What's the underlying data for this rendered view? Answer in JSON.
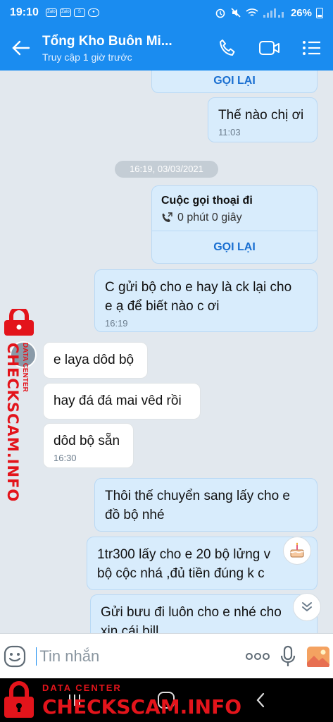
{
  "status_bar": {
    "time": "19:10",
    "notifications": [
      "Zalo",
      "Zalo",
      "S",
      "chat"
    ],
    "battery": "26%"
  },
  "header": {
    "title": "Tổng Kho Buôn Mi...",
    "subtitle": "Truy cập 1 giờ trước",
    "icons": [
      "back-arrow-icon",
      "phone-icon",
      "video-icon",
      "menu-icon"
    ]
  },
  "chat": {
    "top_callback_label": "GỌI LẠI",
    "messages": [
      {
        "side": "out",
        "text": "Thế nào chị ơi",
        "time": "11:03"
      },
      {
        "side": "separator",
        "text": "16:19, 03/03/2021"
      },
      {
        "side": "call",
        "title": "Cuộc gọi thoại đi",
        "duration": "0 phút 0 giây",
        "action": "GỌI LẠI"
      },
      {
        "side": "out",
        "lines": [
          "C gửi bộ cho e hay là ck lại cho",
          "e ạ để biết nào c ơi"
        ],
        "time": "16:19"
      },
      {
        "side": "in",
        "text": "e laya dôd bộ"
      },
      {
        "side": "in",
        "text": "hay đá đá mai vêd rồi"
      },
      {
        "side": "in",
        "text": "dôd bộ sẵn",
        "time": "16:30"
      },
      {
        "side": "out",
        "lines": [
          "Thôi thế chuyển sang lấy cho e",
          "đồ bộ nhé"
        ]
      },
      {
        "side": "out",
        "lines": [
          "1tr300 lấy cho e 20 bộ lửng v",
          "bộ cộc nhá ,đủ tiền đúng k c"
        ]
      },
      {
        "side": "out",
        "lines": [
          "Gửi bưu đi luôn cho e nhé cho",
          "xin cái bill"
        ]
      }
    ]
  },
  "input": {
    "placeholder": "Tin nhắn",
    "icons": [
      "emoji-icon",
      "more-icon",
      "microphone-icon",
      "image-icon"
    ]
  },
  "watermark": {
    "brand": "CHECKSCAM.INFO",
    "tag": "DATA CENTER"
  },
  "colors": {
    "accent": "#1a8cf0",
    "bubble_out": "#d8ecfc",
    "bubble_in": "#ffffff",
    "callback": "#1a6fd1",
    "watermark": "#e3141b"
  }
}
